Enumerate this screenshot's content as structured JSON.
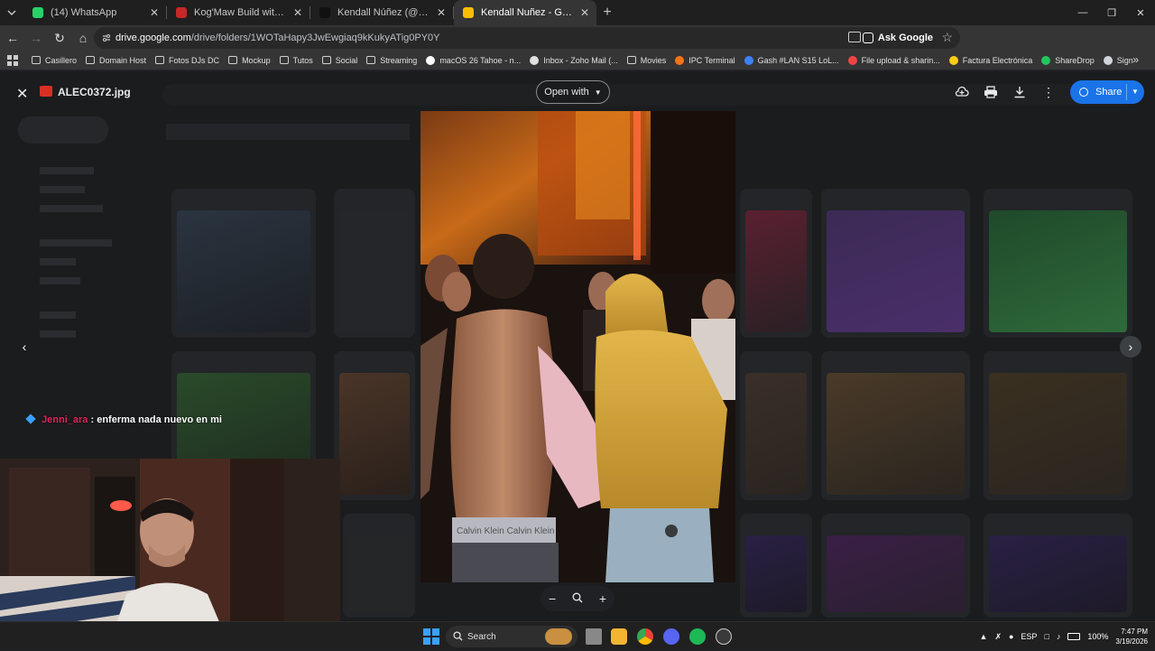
{
  "browser": {
    "tabs": [
      {
        "label": "(14) WhatsApp",
        "color": "#25d366",
        "active": false
      },
      {
        "label": "Kog'Maw Build with Highest W",
        "color": "#c62828",
        "active": false
      },
      {
        "label": "Kendall Núñez (@djkendallnez)",
        "color": "#111111",
        "active": false
      },
      {
        "label": "Kendall Nuñez - Google Drive",
        "color": "#fbbc04",
        "active": true
      }
    ],
    "new_tab": "+",
    "url_host": "drive.google.com",
    "url_path": "/drive/folders/1WOTaHapy3JwEwgiaq9kKukyATig0PY0Y",
    "ask_google": "Ask Google",
    "extension_colors": [
      "#22c55e",
      "#dc2626",
      "#3b82f6",
      "#9ca3af",
      "#ffffff",
      "#9ca3af",
      "#60a5fa"
    ]
  },
  "bookmarks": [
    {
      "label": "Casillero",
      "kind": "folder"
    },
    {
      "label": "Domain Host",
      "kind": "folder"
    },
    {
      "label": "Fotos DJs DC",
      "kind": "folder"
    },
    {
      "label": "Mockup",
      "kind": "folder"
    },
    {
      "label": "Tutos",
      "kind": "folder"
    },
    {
      "label": "Social",
      "kind": "folder"
    },
    {
      "label": "Streaming",
      "kind": "folder"
    },
    {
      "label": "macOS 26 Tahoe - n...",
      "kind": "site",
      "color": "#ffffff"
    },
    {
      "label": "Inbox - Zoho Mail (...",
      "kind": "site",
      "color": "#e0e0e0"
    },
    {
      "label": "Movies",
      "kind": "folder"
    },
    {
      "label": "IPC Terminal",
      "kind": "site",
      "color": "#f97316"
    },
    {
      "label": "Gash #LAN S15 LoL...",
      "kind": "site",
      "color": "#3b82f6"
    },
    {
      "label": "File upload & sharin...",
      "kind": "site",
      "color": "#ef4444"
    },
    {
      "label": "Factura Electrónica",
      "kind": "site",
      "color": "#facc15"
    },
    {
      "label": "ShareDrop",
      "kind": "site",
      "color": "#22c55e"
    },
    {
      "label": "Sign",
      "kind": "site",
      "color": "#d1d5db"
    }
  ],
  "bookmarks_more": "»",
  "viewer": {
    "file_name": "ALEC0372.jpg",
    "open_with": "Open with",
    "share": "Share",
    "prev": "‹",
    "next": "›",
    "zoom_out": "−",
    "zoom_in": "+"
  },
  "chat": {
    "user": "Jenni_ara",
    "message": ": enferma nada nuevo en mi"
  },
  "taskbar": {
    "search": "Search",
    "lang": "ESP",
    "battery": "100%",
    "time": "7:47 PM",
    "date": "3/19/2026"
  }
}
